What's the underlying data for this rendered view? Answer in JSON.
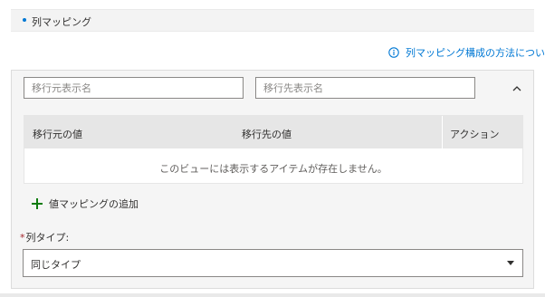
{
  "section": {
    "title": "列マッピング",
    "help_link": "列マッピング構成の方法について"
  },
  "filters": {
    "source_placeholder": "移行元表示名",
    "target_placeholder": "移行先表示名"
  },
  "collapse_icon": "chevron-up-icon",
  "grid": {
    "columns": [
      "移行元の値",
      "移行先の値",
      "アクション"
    ],
    "rows": [],
    "empty_message": "このビューには表示するアイテムが存在しません。"
  },
  "add_mapping": {
    "label": "値マッピングの追加",
    "icon": "plus-icon"
  },
  "column_type": {
    "required_mark": "*",
    "label": "列タイプ:",
    "selected": "同じタイプ"
  },
  "colors": {
    "accent": "#0078d4",
    "add_icon": "#107c10",
    "required": "#a4262c"
  }
}
